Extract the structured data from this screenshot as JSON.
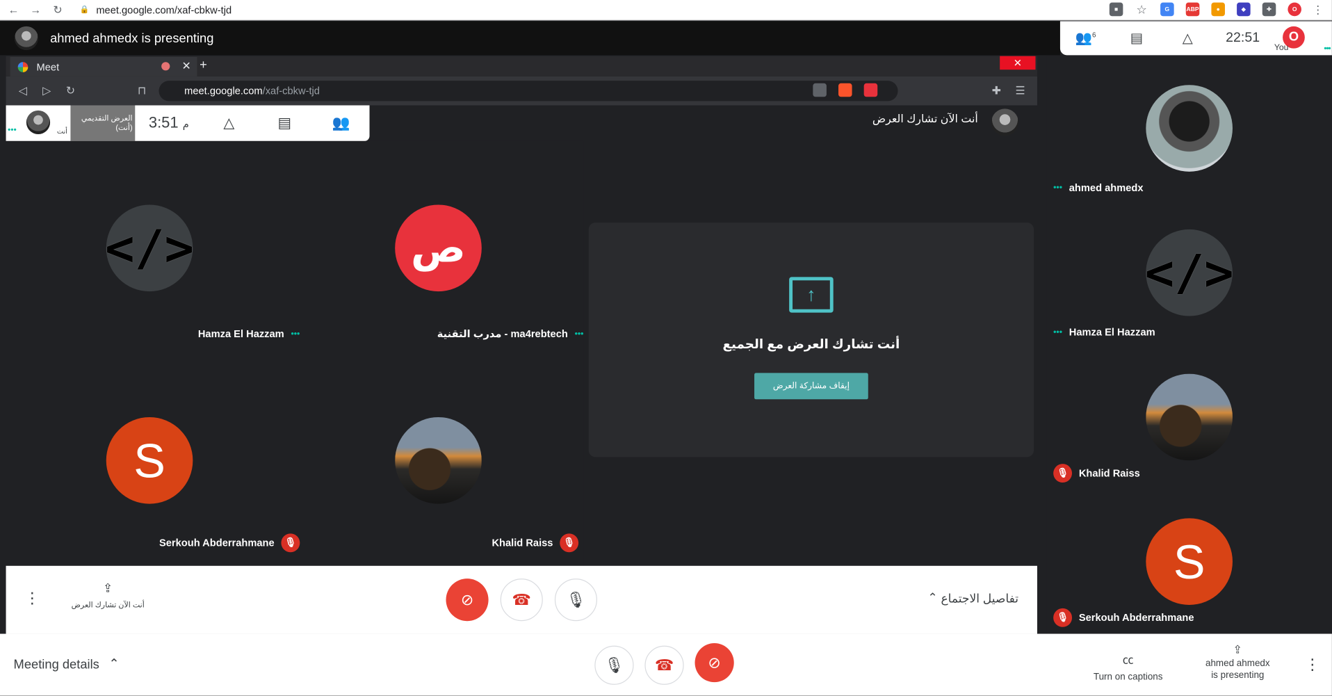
{
  "browser": {
    "url": "meet.google.com/xaf-cbkw-tjd",
    "extensions": [
      "camera-off-icon",
      "star-icon",
      "translate-icon",
      "adblock-icon",
      "ext-icon",
      "ext-icon",
      "puzzle-icon",
      "meet-logo-icon"
    ]
  },
  "presenter_bar": {
    "title": "ahmed ahmedx is presenting"
  },
  "top_controls": {
    "time": "22:51",
    "you_label": "You",
    "participant_count": "6"
  },
  "inner_browser": {
    "tab_title": "Meet",
    "url_domain": "meet.google.com",
    "url_path": "/xaf-cbkw-tjd"
  },
  "inner_meet": {
    "time": "3:51",
    "time_suffix": "م",
    "presenting_thumb": "العرض التقديمي (أنت)",
    "you_label": "أنت",
    "sharing_header": "أنت الآن تشارك العرض",
    "share_message": "أنت تشارك العرض مع الجميع",
    "stop_button": "إيقاف مشاركة العرض",
    "presenting_label": "أنت الآن تشارك العرض",
    "details_label": "تفاصيل الاجتماع",
    "tiles": [
      {
        "name": "Hamza El Hazzam",
        "status": "•••"
      },
      {
        "name": "مدرب التقنية - ma4rebtech",
        "status": "•••"
      },
      {
        "name": "Serkouh Abderrahmane",
        "status": "muted"
      },
      {
        "name": "Khalid Raiss",
        "status": "muted"
      }
    ]
  },
  "participants": [
    {
      "name": "ahmed ahmedx",
      "status": "•••"
    },
    {
      "name": "Hamza El Hazzam",
      "status": "•••"
    },
    {
      "name": "Khalid Raiss",
      "status": "muted"
    },
    {
      "name": "Serkouh Abderrahmane",
      "status": "muted"
    }
  ],
  "avatar_letter": "S",
  "code_symbol": "</>",
  "bottom_bar": {
    "meeting_details": "Meeting details",
    "captions": "Turn on captions",
    "presenting_line1": "ahmed ahmedx",
    "presenting_line2": "is presenting"
  },
  "colors": {
    "accent_red": "#ea4335",
    "teal": "#4ea8a6",
    "dark_bg": "#202124"
  }
}
